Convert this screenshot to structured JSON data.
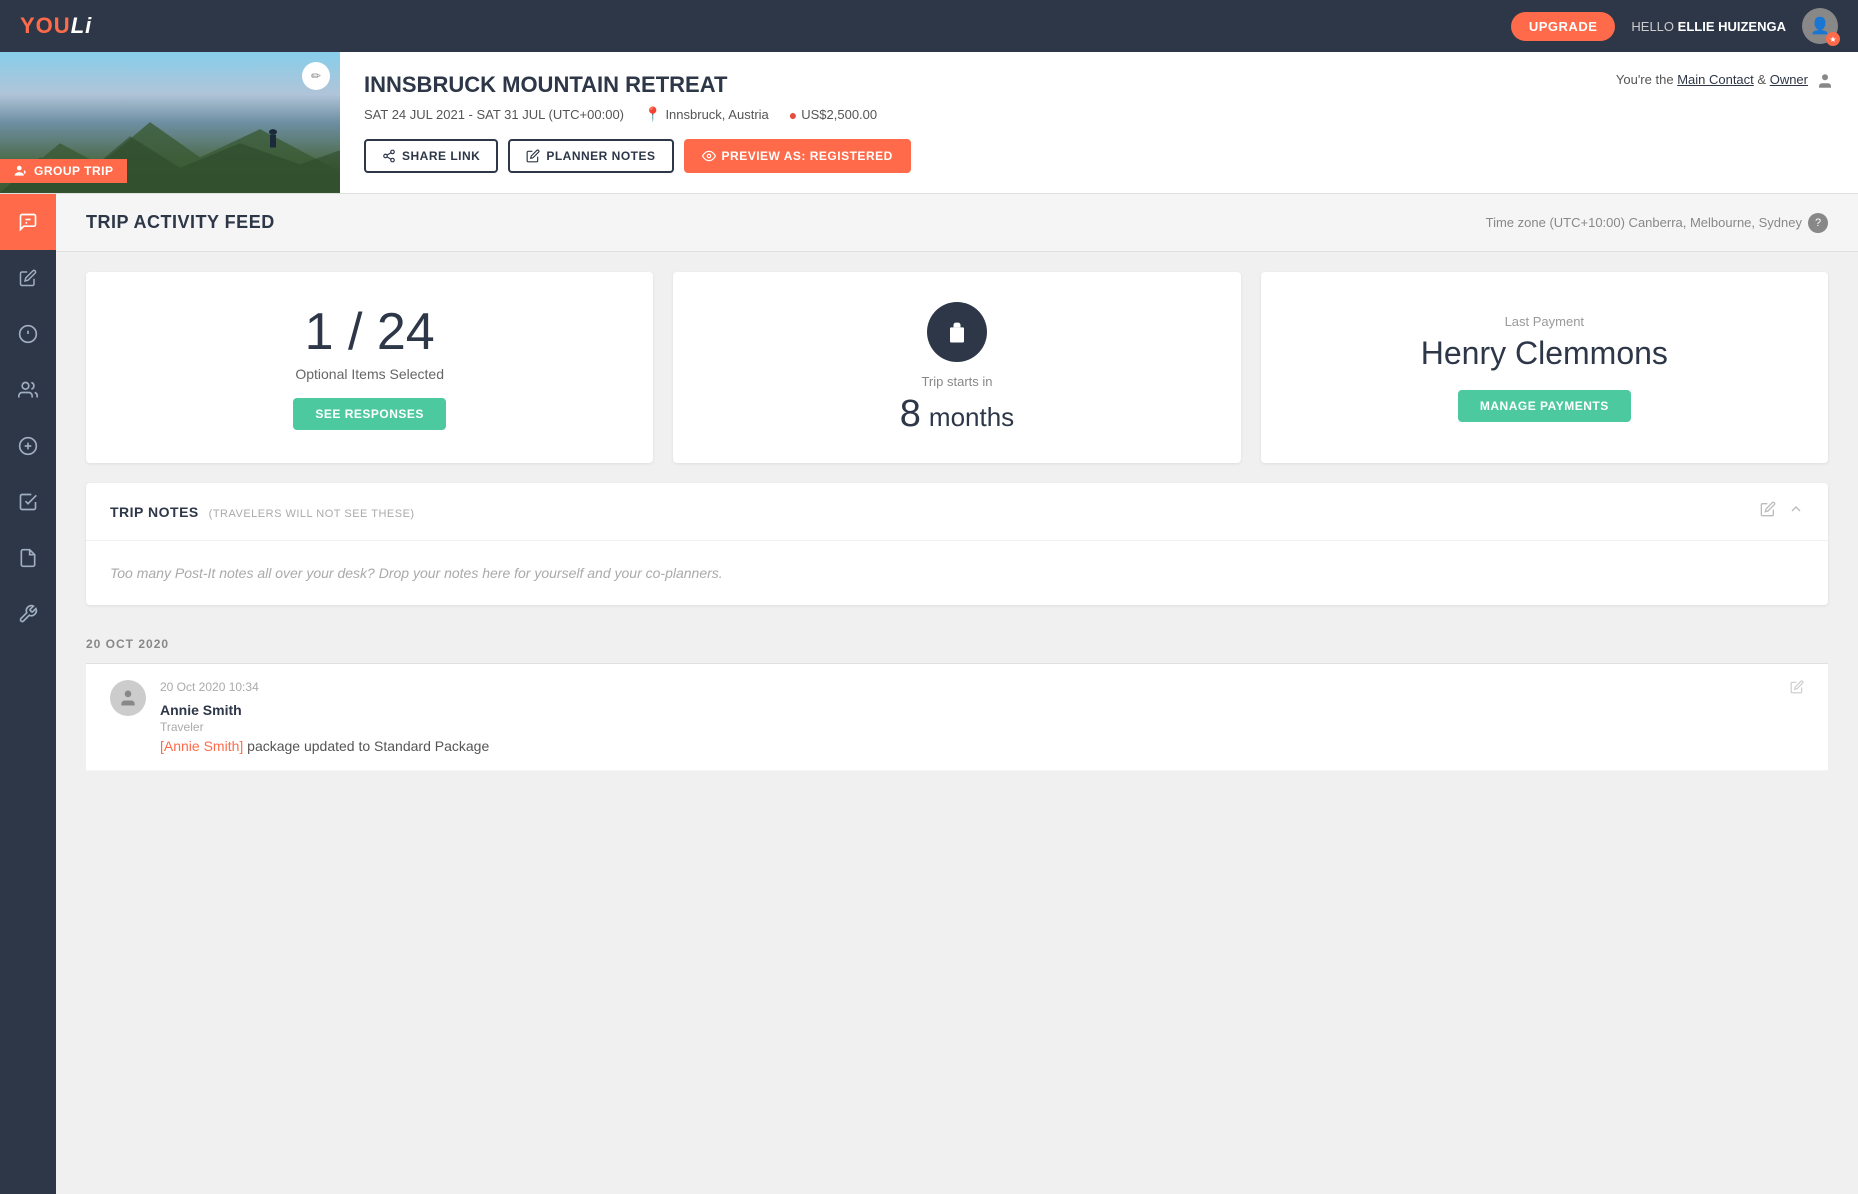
{
  "topNav": {
    "logo": "YOULi",
    "upgradeLabel": "UPGRADE",
    "helloText": "HELLO",
    "userName": "ELLIE HUIZENGA"
  },
  "tripHeader": {
    "title": "INNSBRUCK MOUNTAIN RETREAT",
    "dates": "SAT 24 JUL 2021 - SAT 31 JUL (UTC+00:00)",
    "location": "Innsbruck, Austria",
    "price": "US$2,500.00",
    "groupTripLabel": "GROUP TRIP",
    "contactText": "You're the",
    "mainContactLabel": "Main Contact",
    "andText": "&",
    "ownerLabel": "Owner",
    "buttons": {
      "shareLink": "SHARE LINK",
      "plannerNotes": "PLANNER NOTES",
      "previewAs": "PREVIEW AS: REGISTERED"
    }
  },
  "sidebar": {
    "items": [
      {
        "icon": "activity-feed-icon",
        "label": "Activity Feed",
        "active": true
      },
      {
        "icon": "edit-icon",
        "label": "Edit",
        "active": false
      },
      {
        "icon": "info-icon",
        "label": "Info",
        "active": false
      },
      {
        "icon": "people-icon",
        "label": "People",
        "active": false
      },
      {
        "icon": "payments-icon",
        "label": "Payments",
        "active": false
      },
      {
        "icon": "checklist-icon",
        "label": "Checklist",
        "active": false
      },
      {
        "icon": "document-icon",
        "label": "Document",
        "active": false
      },
      {
        "icon": "settings-icon",
        "label": "Settings",
        "active": false
      }
    ]
  },
  "pageHeader": {
    "title": "TRIP ACTIVITY FEED",
    "timezone": "Time zone (UTC+10:00) Canberra, Melbourne, Sydney"
  },
  "statCards": {
    "optionalItems": {
      "number": "1 / 24",
      "label": "Optional Items Selected",
      "buttonLabel": "SEE RESPONSES"
    },
    "tripStarts": {
      "label": "Trip starts in",
      "number": "8",
      "unit": "months"
    },
    "lastPayment": {
      "label": "Last Payment",
      "name": "Henry Clemmons",
      "buttonLabel": "MANAGE PAYMENTS"
    }
  },
  "tripNotes": {
    "title": "TRIP NOTES",
    "subtitle": "(TRAVELERS WILL NOT SEE THESE)",
    "placeholder": "Too many Post-It notes all over your desk? Drop your notes here for yourself and your co-planners."
  },
  "activityFeed": {
    "dateLabel": "20 OCT 2020",
    "items": [
      {
        "timestamp": "20 Oct 2020 10:34",
        "name": "Annie Smith",
        "role": "Traveler",
        "linkText": "[Annie Smith]",
        "activityText": " package updated to Standard Package"
      }
    ]
  }
}
